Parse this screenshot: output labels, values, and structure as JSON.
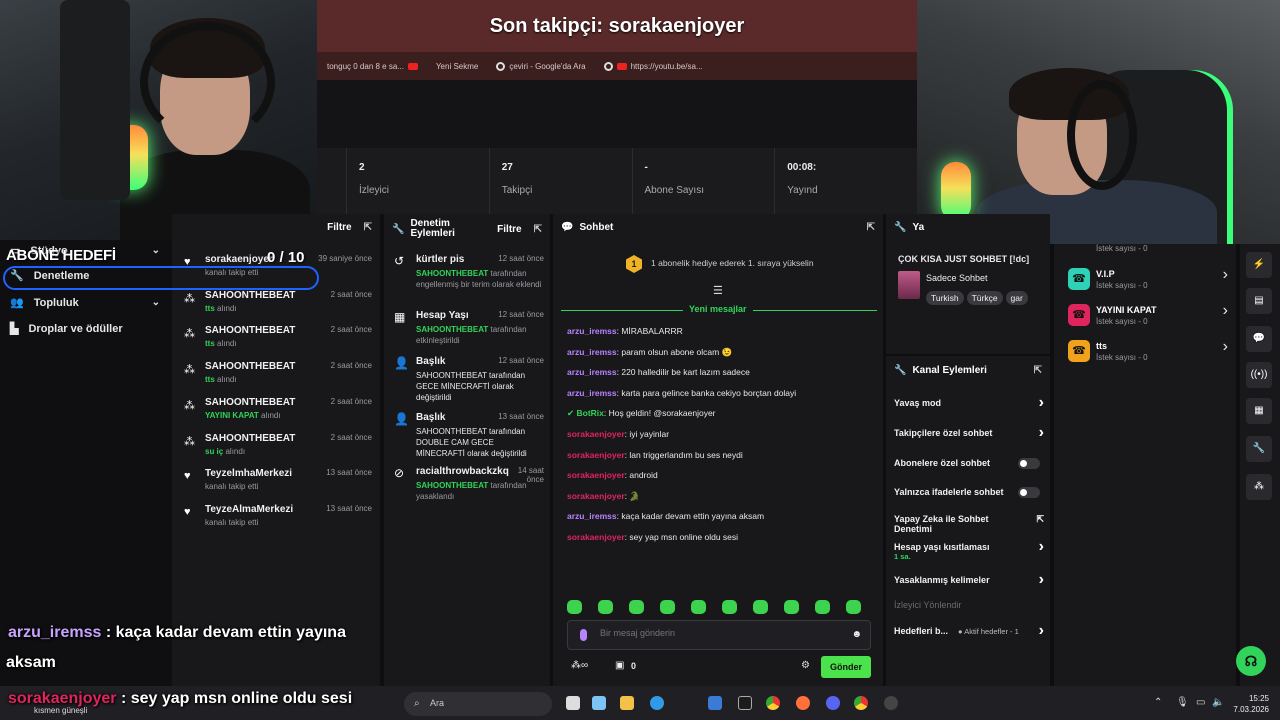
{
  "banner": {
    "title": "Son takipçi: sorakaenjoyer"
  },
  "browser_tabs": [
    {
      "label": "tonguç 0 dan 8 e sa...",
      "icon": "youtube-icon"
    },
    {
      "label": "Yeni Sekme",
      "icon": "youtube-icon"
    },
    {
      "label": "çeviri - Google'da Ara",
      "icon": "google-icon"
    },
    {
      "label": "https://youtu.be/sa...",
      "icon": "youtube-icon"
    }
  ],
  "stats": [
    {
      "value": "2",
      "label": "İzleyici"
    },
    {
      "value": "27",
      "label": "Takipçi"
    },
    {
      "value": "-",
      "label": "Abone Sayısı"
    },
    {
      "value": "00:08:",
      "label": "Yayınd"
    }
  ],
  "goal": {
    "label": "ABONE HEDEFİ",
    "count": "0   / 10"
  },
  "nav": {
    "items": [
      {
        "label": "Stüdyo",
        "icon": "monitor-icon"
      },
      {
        "label": "Denetleme",
        "icon": "wrench-icon"
      },
      {
        "label": "Topluluk",
        "icon": "people-icon"
      },
      {
        "label": "Droplar ve ödüller",
        "icon": "chart-icon"
      }
    ]
  },
  "feed": {
    "filter": "Filtre",
    "rows": [
      {
        "name": "sorakaenjoyer",
        "time": "39 saniye önce",
        "action": "kanalı takip etti",
        "highlight": ""
      },
      {
        "name": "SAHOONTHEBEAT",
        "time": "2 saat önce",
        "action": "alındı",
        "highlight": "tts"
      },
      {
        "name": "SAHOONTHEBEAT",
        "time": "2 saat önce",
        "action": "alındı",
        "highlight": "tts"
      },
      {
        "name": "SAHOONTHEBEAT",
        "time": "2 saat önce",
        "action": "alındı",
        "highlight": "tts"
      },
      {
        "name": "SAHOONTHEBEAT",
        "time": "2 saat önce",
        "action": "alındı",
        "highlight": "YAYINI KAPAT"
      },
      {
        "name": "SAHOONTHEBEAT",
        "time": "2 saat önce",
        "action": "alındı",
        "highlight": "su iç"
      },
      {
        "name": "TeyzelmhaMerkezi",
        "time": "13 saat önce",
        "action": "kanalı takip etti",
        "highlight": ""
      },
      {
        "name": "TeyzeAlmaMerkezi",
        "time": "13 saat önce",
        "action": "kanalı takip etti",
        "highlight": ""
      }
    ]
  },
  "moderation": {
    "title": "Denetim Eylemleri",
    "filter": "Filtre",
    "rows": [
      {
        "title": "kürtler pis",
        "time": "12 saat önce",
        "actor": "SAHOONTHEBEAT",
        "desc": "tarafından engellenmiş bir terim olarak eklendi",
        "icon": "undo-icon"
      },
      {
        "title": "Hesap Yaşı",
        "time": "12 saat önce",
        "actor": "SAHOONTHEBEAT",
        "desc": "tarafından etkinleştirildi",
        "icon": "calendar-icon"
      },
      {
        "title": "Başlık",
        "time": "12 saat önce",
        "actor": "",
        "desc": "SAHOONTHEBEAT tarafından GECE MİNECRAFTİ olarak değiştirildi",
        "icon": "user-edit-icon"
      },
      {
        "title": "Başlık",
        "time": "13 saat önce",
        "actor": "",
        "desc": "SAHOONTHEBEAT tarafından DOUBLE CAM GECE MİNECRAFTİ olarak değiştirildi",
        "icon": "user-edit-icon"
      },
      {
        "title": "racialthrowbackzkq",
        "time": "14 saat önce",
        "actor": "SAHOONTHEBEAT",
        "desc": "tarafından yasaklandı",
        "icon": "ban-icon"
      }
    ]
  },
  "chat": {
    "title": "Sohbet",
    "gift_badge": "1",
    "gift_text": "1 abonelik hediye ederek 1. sıraya yükselin",
    "new_messages": "Yeni mesajlar",
    "messages": [
      {
        "user": "arzu_iremss",
        "text": ": MİRABALARRR",
        "color": "purple"
      },
      {
        "user": "arzu_iremss",
        "text": ": param olsun abone olcam 😉",
        "color": "purple"
      },
      {
        "user": "arzu_iremss",
        "text": ": 220 halledilir be kart lazım sadece",
        "color": "purple"
      },
      {
        "user": "arzu_iremss",
        "text": ": karta para gelince banka cekiyo borçtan dolayi",
        "color": "purple"
      },
      {
        "user": "BotRix",
        "text": ": Hoş geldin! @sorakaenjoyer",
        "color": "green"
      },
      {
        "user": "sorakaenjoyer",
        "text": ": iyi yayinlar",
        "color": "red"
      },
      {
        "user": "sorakaenjoyer",
        "text": ": lan triggerlandım bu ses neydi",
        "color": "red"
      },
      {
        "user": "sorakaenjoyer",
        "text": ": android",
        "color": "red"
      },
      {
        "user": "sorakaenjoyer",
        "text": ": 🐊",
        "color": "red"
      },
      {
        "user": "arzu_iremss",
        "text": ": kaça kadar devam ettin yayına aksam",
        "color": "purple"
      },
      {
        "user": "sorakaenjoyer",
        "text": ": sey yap msn online oldu sesi",
        "color": "red"
      }
    ],
    "input_placeholder": "Bir mesaj gönderin",
    "points": "0",
    "send": "Gönder"
  },
  "channel": {
    "title_prefix": "Ya",
    "stream_title": "ÇOK KISA JUST SOHBET [!dc]",
    "category": "Sadece Sohbet",
    "tags": [
      "Turkish",
      "Türkçe",
      "gar"
    ]
  },
  "actions": {
    "title": "Kanal Eylemleri",
    "items": [
      {
        "label": "Yavaş mod",
        "type": "arrow",
        "sub": ""
      },
      {
        "label": "Takipçilere özel sohbet",
        "type": "arrow",
        "sub": ""
      },
      {
        "label": "Abonelere özel sohbet",
        "type": "toggle",
        "sub": ""
      },
      {
        "label": "Yalnızca ifadelerle sohbet",
        "type": "toggle",
        "sub": ""
      },
      {
        "label": "Yapay Zeka ile Sohbet Denetimi",
        "type": "external",
        "sub": ""
      },
      {
        "label": "Hesap yaşı kısıtlaması",
        "type": "arrow",
        "sub": "1 sa."
      },
      {
        "label": "Yasaklanmış kelimeler",
        "type": "arrow",
        "sub": ""
      },
      {
        "label": "İzleyici Yönlendir",
        "type": "disabled",
        "sub": ""
      },
      {
        "label": "Hedefleri b...",
        "type": "arrow",
        "sub": "● Aktif hedefler - 1"
      }
    ]
  },
  "rewards": [
    {
      "name": "",
      "sub": "İstek sayısı - 0",
      "color": "#31d35a"
    },
    {
      "name": "V.I.P",
      "sub": "İstek sayısı - 0",
      "color": "#2ed3b7"
    },
    {
      "name": "YAYINI KAPAT",
      "sub": "İstek sayısı - 0",
      "color": "#e0245e"
    },
    {
      "name": "tts",
      "sub": "İstek sayısı - 0",
      "color": "#f0a21c"
    }
  ],
  "overlay_chat": [
    {
      "user": "arzu_iremss",
      "text": " : kaça kadar devam ettin yayına",
      "text2": "aksam"
    },
    {
      "user": "sorakaenjoyer",
      "text": " : sey yap msn online oldu sesi"
    }
  ],
  "taskbar": {
    "weather": "kısmen güneşli",
    "search": "Ara",
    "time": "15:25",
    "date": "7.03.2026"
  }
}
